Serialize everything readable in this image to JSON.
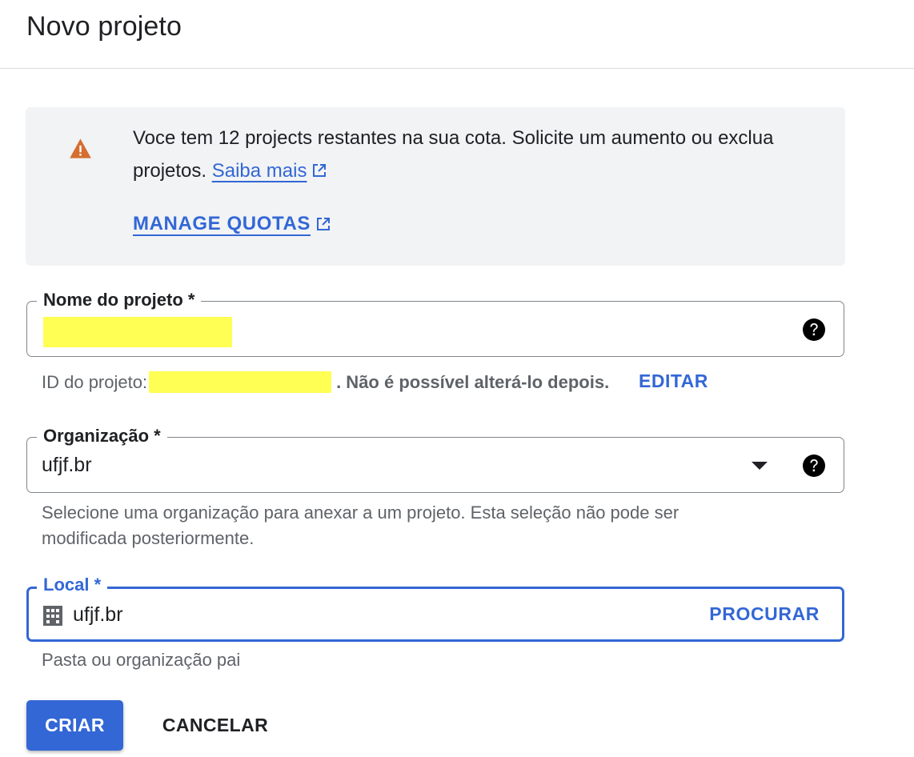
{
  "page": {
    "title": "Novo projeto"
  },
  "quota_notice": {
    "text": "Voce tem 12 projects restantes na sua cota. Solicite um aumento ou exclua projetos.",
    "learn_more_label": "Saiba mais",
    "manage_quotas_label": "MANAGE QUOTAS",
    "icons": {
      "warning": "warning-icon",
      "external": "external-link-icon"
    },
    "warning_color": "#e8710a"
  },
  "project_name": {
    "label": "Nome do projeto *",
    "value": "",
    "help_icon": "help-icon"
  },
  "project_id": {
    "prefix": "ID do projeto:",
    "suffix": ". Não é possível alterá-lo depois.",
    "edit_label": "EDITAR"
  },
  "organization": {
    "label": "Organização *",
    "selected": "ufjf.br",
    "help_text": "Selecione uma organização para anexar a um projeto. Esta seleção não pode ser modificada posteriormente."
  },
  "location": {
    "label": "Local *",
    "value": "ufjf.br",
    "browse_label": "PROCURAR",
    "help_text": "Pasta ou organização pai",
    "icon": "building-icon"
  },
  "actions": {
    "create_label": "CRIAR",
    "cancel_label": "CANCELAR"
  },
  "colors": {
    "accent": "#3367d6",
    "redaction": "#ffff54",
    "notice_bg": "#f1f3f4"
  }
}
